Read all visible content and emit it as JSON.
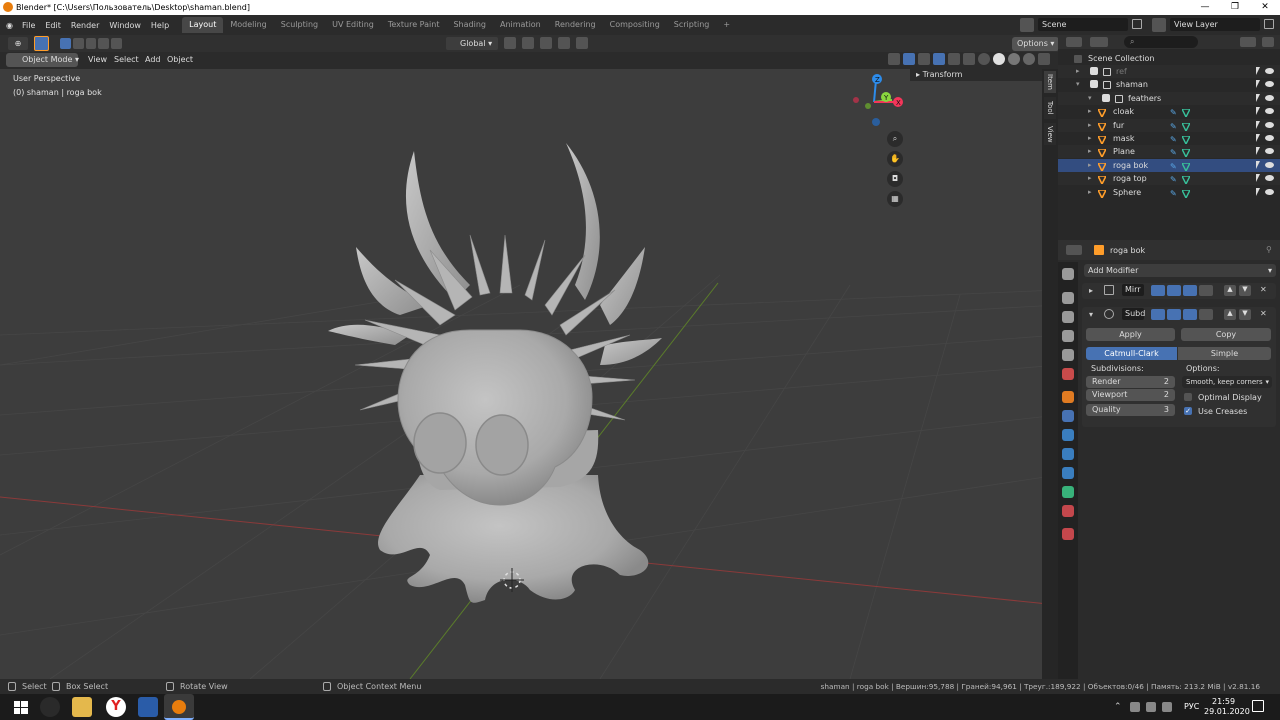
{
  "window": {
    "title": "Blender* [C:\\Users\\Пользователь\\Desktop\\shaman.blend]",
    "controls": [
      "—",
      "❐",
      "✕"
    ]
  },
  "menu": [
    "File",
    "Edit",
    "Render",
    "Window",
    "Help"
  ],
  "workspaces": [
    "Layout",
    "Modeling",
    "Sculpting",
    "UV Editing",
    "Texture Paint",
    "Shading",
    "Animation",
    "Rendering",
    "Compositing",
    "Scripting",
    "+"
  ],
  "scene": {
    "label": "Scene",
    "view_layer": "View Layer"
  },
  "viewport": {
    "transform_orientation": "Global",
    "options": "Options",
    "mode": "Object Mode",
    "menus": [
      "View",
      "Select",
      "Add",
      "Object"
    ],
    "perspective": "User Perspective",
    "object_info": "(0) shaman | roga bok",
    "n_panel_tabs": [
      "Item",
      "Tool",
      "View"
    ],
    "transform_panel": "Transform",
    "gizmo": {
      "z": "Z",
      "y": "Y",
      "x": "X"
    }
  },
  "outliner": {
    "title": "Scene Collection",
    "items": [
      {
        "name": "ref",
        "type": "collection",
        "indent": 1,
        "dim": true
      },
      {
        "name": "shaman",
        "type": "collection",
        "indent": 1
      },
      {
        "name": "feathers",
        "type": "collection",
        "indent": 2
      },
      {
        "name": "cloak",
        "type": "mesh",
        "indent": 2
      },
      {
        "name": "fur",
        "type": "mesh",
        "indent": 2
      },
      {
        "name": "mask",
        "type": "mesh",
        "indent": 2
      },
      {
        "name": "Plane",
        "type": "mesh",
        "indent": 2
      },
      {
        "name": "roga bok",
        "type": "mesh",
        "indent": 2,
        "selected": true
      },
      {
        "name": "roga top",
        "type": "mesh",
        "indent": 2
      },
      {
        "name": "Sphere",
        "type": "mesh",
        "indent": 2
      }
    ]
  },
  "properties": {
    "object": "roga bok",
    "add_modifier": "Add Modifier",
    "modifiers": [
      {
        "name": "Mirr"
      },
      {
        "name": "Subd"
      }
    ],
    "apply": "Apply",
    "copy": "Copy",
    "catmull": "Catmull-Clark",
    "simple": "Simple",
    "subdivisions_label": "Subdivisions:",
    "options_label": "Options:",
    "render_label": "Render",
    "render_value": "2",
    "viewport_label": "Viewport",
    "viewport_value": "2",
    "quality_label": "Quality",
    "quality_value": "3",
    "uv_smooth": "Smooth, keep corners",
    "optimal_display": "Optimal Display",
    "use_creases": "Use Creases"
  },
  "statusbar": {
    "select": "Select",
    "box_select": "Box Select",
    "rotate_view": "Rotate View",
    "context_menu": "Object Context Menu",
    "stats": "shaman | roga bok | Вершин:95,788 | Граней:94,961 | Треуг.:189,922 | Объектов:0/46 | Память: 213.2 MiB | v2.81.16"
  },
  "taskbar": {
    "lang": "РУС",
    "time": "21:59",
    "date": "29.01.2020"
  },
  "colors": {
    "accent": "#4772b3",
    "selected_row": "#334d80",
    "mesh_icon": "#ff9d2a",
    "gizmo_x": "#f4365a",
    "gizmo_y": "#8ad63e",
    "gizmo_z": "#2d8ceb"
  }
}
